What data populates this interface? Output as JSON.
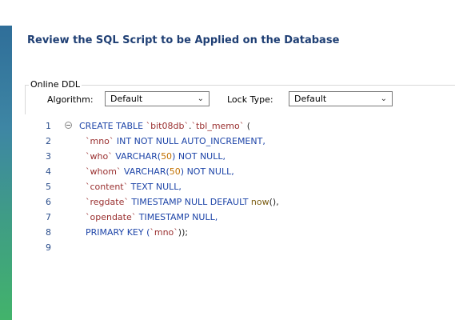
{
  "header": {
    "title": "Review the SQL Script to be Applied on the Database"
  },
  "ddl": {
    "group_label": "Online DDL",
    "algorithm_label": "Algorithm:",
    "algorithm_value": "Default",
    "lock_label": "Lock Type:",
    "lock_value": "Default"
  },
  "script": {
    "line_numbers": [
      "1",
      "2",
      "3",
      "4",
      "5",
      "6",
      "7",
      "8",
      "9"
    ],
    "l1": {
      "kw1": "CREATE TABLE",
      "id1": "`bit08db`",
      "p1": ".",
      "id2": "`tbl_memo`",
      "p2": " ("
    },
    "l2": {
      "id": "`mno`",
      "kw": " INT NOT NULL AUTO_INCREMENT,"
    },
    "l3": {
      "id": "`who`",
      "kw1": " VARCHAR(",
      "num": "50",
      "kw2": ") NOT NULL,"
    },
    "l4": {
      "id": "`whom`",
      "kw1": " VARCHAR(",
      "num": "50",
      "kw2": ") NOT NULL,"
    },
    "l5": {
      "id": "`content`",
      "kw": " TEXT NULL,"
    },
    "l6": {
      "id": "`regdate`",
      "kw": " TIMESTAMP NULL DEFAULT ",
      "fn": "now",
      "p": "(),"
    },
    "l7": {
      "id": "`opendate`",
      "kw": " TIMESTAMP NULL,"
    },
    "l8": {
      "kw": "PRIMARY KEY (",
      "id": "`mno`",
      "p": "));"
    }
  },
  "icons": {
    "fold": "fold-collapse-icon",
    "dropdown": "chevron-down-icon"
  },
  "colors": {
    "title": "#1f3f74",
    "keyword": "#1e45a8",
    "identifier": "#9a3030",
    "number": "#c27100"
  }
}
